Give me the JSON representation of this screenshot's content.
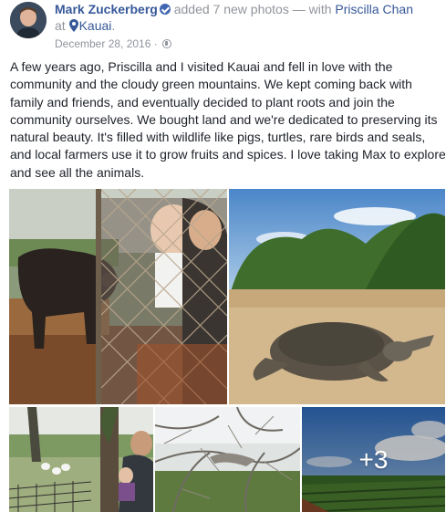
{
  "post": {
    "author": "Mark Zuckerberg",
    "action_text": "added 7 new photos — with",
    "tagged_person": "Priscilla Chan",
    "at_text": "at",
    "location": "Kauai",
    "location_suffix": ".",
    "date": "December 28, 2016",
    "separator": "·",
    "privacy_icon": "globe-icon",
    "verified_icon": "verified-badge-icon",
    "location_icon": "map-pin-icon",
    "text": "A few years ago, Priscilla and I visited Kauai and fell in love with the community and the cloudy green mountains. We kept coming back with family and friends, and eventually decided to plant roots and join the community ourselves. We bought land and we're dedicated to preserving its natural beauty. It's filled with wildlife like pigs, turtles, rare birds and seals, and local farmers use it to grow fruits and spices. I love taking Max to explore and see all the animals.",
    "more_photos": "+3"
  },
  "colors": {
    "link": "#365899",
    "meta": "#90949c",
    "text": "#1d2129",
    "verified": "#4267b2"
  }
}
